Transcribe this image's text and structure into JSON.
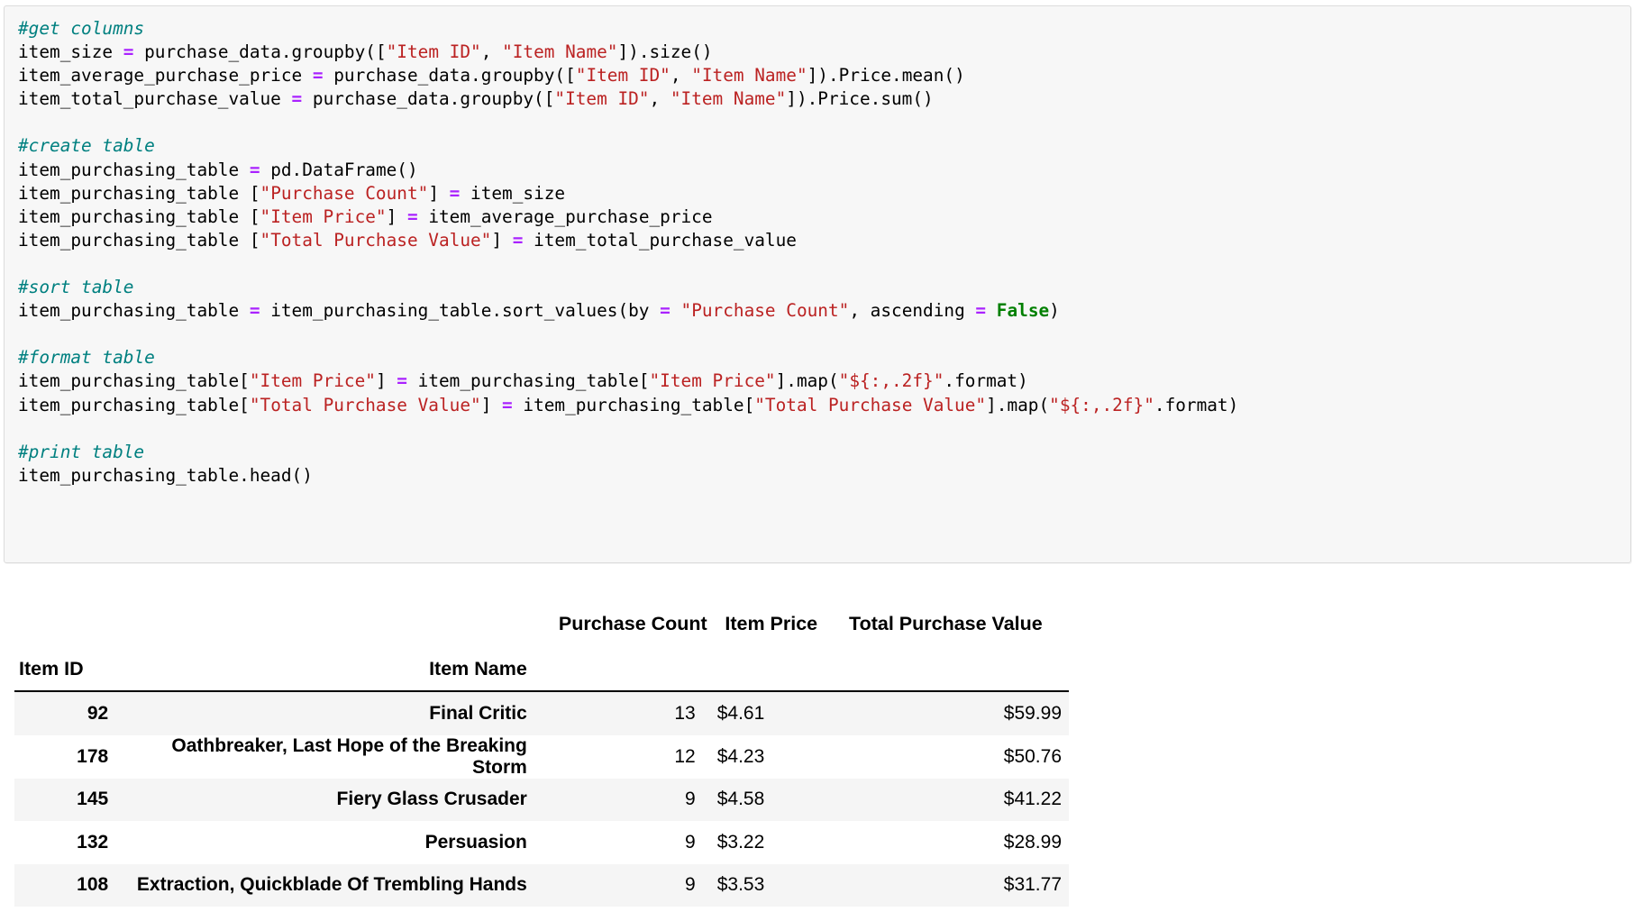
{
  "code_cell": {
    "lines": [
      [
        {
          "t": "#get columns",
          "c": "cmt"
        }
      ],
      [
        {
          "t": "item_size ",
          "c": ""
        },
        {
          "t": "=",
          "c": "op"
        },
        {
          "t": " purchase_data.groupby([",
          "c": ""
        },
        {
          "t": "\"Item ID\"",
          "c": "str"
        },
        {
          "t": ", ",
          "c": ""
        },
        {
          "t": "\"Item Name\"",
          "c": "str"
        },
        {
          "t": "]).size()",
          "c": ""
        }
      ],
      [
        {
          "t": "item_average_purchase_price ",
          "c": ""
        },
        {
          "t": "=",
          "c": "op"
        },
        {
          "t": " purchase_data.groupby([",
          "c": ""
        },
        {
          "t": "\"Item ID\"",
          "c": "str"
        },
        {
          "t": ", ",
          "c": ""
        },
        {
          "t": "\"Item Name\"",
          "c": "str"
        },
        {
          "t": "]).Price.mean()",
          "c": ""
        }
      ],
      [
        {
          "t": "item_total_purchase_value ",
          "c": ""
        },
        {
          "t": "=",
          "c": "op"
        },
        {
          "t": " purchase_data.groupby([",
          "c": ""
        },
        {
          "t": "\"Item ID\"",
          "c": "str"
        },
        {
          "t": ", ",
          "c": ""
        },
        {
          "t": "\"Item Name\"",
          "c": "str"
        },
        {
          "t": "]).Price.sum()",
          "c": ""
        }
      ],
      [],
      [
        {
          "t": "#create table",
          "c": "cmt"
        }
      ],
      [
        {
          "t": "item_purchasing_table ",
          "c": ""
        },
        {
          "t": "=",
          "c": "op"
        },
        {
          "t": " pd.DataFrame()",
          "c": ""
        }
      ],
      [
        {
          "t": "item_purchasing_table [",
          "c": ""
        },
        {
          "t": "\"Purchase Count\"",
          "c": "str"
        },
        {
          "t": "] ",
          "c": ""
        },
        {
          "t": "=",
          "c": "op"
        },
        {
          "t": " item_size",
          "c": ""
        }
      ],
      [
        {
          "t": "item_purchasing_table [",
          "c": ""
        },
        {
          "t": "\"Item Price\"",
          "c": "str"
        },
        {
          "t": "] ",
          "c": ""
        },
        {
          "t": "=",
          "c": "op"
        },
        {
          "t": " item_average_purchase_price",
          "c": ""
        }
      ],
      [
        {
          "t": "item_purchasing_table [",
          "c": ""
        },
        {
          "t": "\"Total Purchase Value\"",
          "c": "str"
        },
        {
          "t": "] ",
          "c": ""
        },
        {
          "t": "=",
          "c": "op"
        },
        {
          "t": " item_total_purchase_value",
          "c": ""
        }
      ],
      [],
      [
        {
          "t": "#sort table",
          "c": "cmt"
        }
      ],
      [
        {
          "t": "item_purchasing_table ",
          "c": ""
        },
        {
          "t": "=",
          "c": "op"
        },
        {
          "t": " item_purchasing_table.sort_values(by ",
          "c": ""
        },
        {
          "t": "=",
          "c": "op"
        },
        {
          "t": " ",
          "c": ""
        },
        {
          "t": "\"Purchase Count\"",
          "c": "str"
        },
        {
          "t": ", ascending ",
          "c": ""
        },
        {
          "t": "=",
          "c": "op"
        },
        {
          "t": " ",
          "c": ""
        },
        {
          "t": "False",
          "c": "kw"
        },
        {
          "t": ")",
          "c": ""
        }
      ],
      [],
      [
        {
          "t": "#format table",
          "c": "cmt"
        }
      ],
      [
        {
          "t": "item_purchasing_table[",
          "c": ""
        },
        {
          "t": "\"Item Price\"",
          "c": "str"
        },
        {
          "t": "] ",
          "c": ""
        },
        {
          "t": "=",
          "c": "op"
        },
        {
          "t": " item_purchasing_table[",
          "c": ""
        },
        {
          "t": "\"Item Price\"",
          "c": "str"
        },
        {
          "t": "].map(",
          "c": ""
        },
        {
          "t": "\"${:,.2f}\"",
          "c": "str"
        },
        {
          "t": ".format)",
          "c": ""
        }
      ],
      [
        {
          "t": "item_purchasing_table[",
          "c": ""
        },
        {
          "t": "\"Total Purchase Value\"",
          "c": "str"
        },
        {
          "t": "] ",
          "c": ""
        },
        {
          "t": "=",
          "c": "op"
        },
        {
          "t": " item_purchasing_table[",
          "c": ""
        },
        {
          "t": "\"Total Purchase Value\"",
          "c": "str"
        },
        {
          "t": "].map(",
          "c": ""
        },
        {
          "t": "\"${:,.2f}\"",
          "c": "str"
        },
        {
          "t": ".format)",
          "c": ""
        }
      ],
      [],
      [
        {
          "t": "#print table",
          "c": "cmt"
        }
      ],
      [
        {
          "t": "item_purchasing_table.head()",
          "c": ""
        }
      ]
    ]
  },
  "output_table": {
    "measure_headers": [
      "Purchase Count",
      "Item Price",
      "Total Purchase Value"
    ],
    "index_headers": [
      "Item ID",
      "Item Name"
    ],
    "rows": [
      {
        "item_id": "92",
        "item_name": "Final Critic",
        "purchase_count": "13",
        "item_price": "$4.61",
        "total_purchase_value": "$59.99"
      },
      {
        "item_id": "178",
        "item_name": "Oathbreaker, Last Hope of the Breaking Storm",
        "purchase_count": "12",
        "item_price": "$4.23",
        "total_purchase_value": "$50.76"
      },
      {
        "item_id": "145",
        "item_name": "Fiery Glass Crusader",
        "purchase_count": "9",
        "item_price": "$4.58",
        "total_purchase_value": "$41.22"
      },
      {
        "item_id": "132",
        "item_name": "Persuasion",
        "purchase_count": "9",
        "item_price": "$3.22",
        "total_purchase_value": "$28.99"
      },
      {
        "item_id": "108",
        "item_name": "Extraction, Quickblade Of Trembling Hands",
        "purchase_count": "9",
        "item_price": "$3.53",
        "total_purchase_value": "$31.77"
      }
    ]
  },
  "colors": {
    "code_background": "#f7f7f7",
    "code_border": "#dcdcdc",
    "comment": "#008080",
    "string": "#bb2222",
    "operator": "#aa22ff",
    "keyword": "#008000",
    "row_stripe": "#f5f5f5",
    "text": "#000000"
  }
}
